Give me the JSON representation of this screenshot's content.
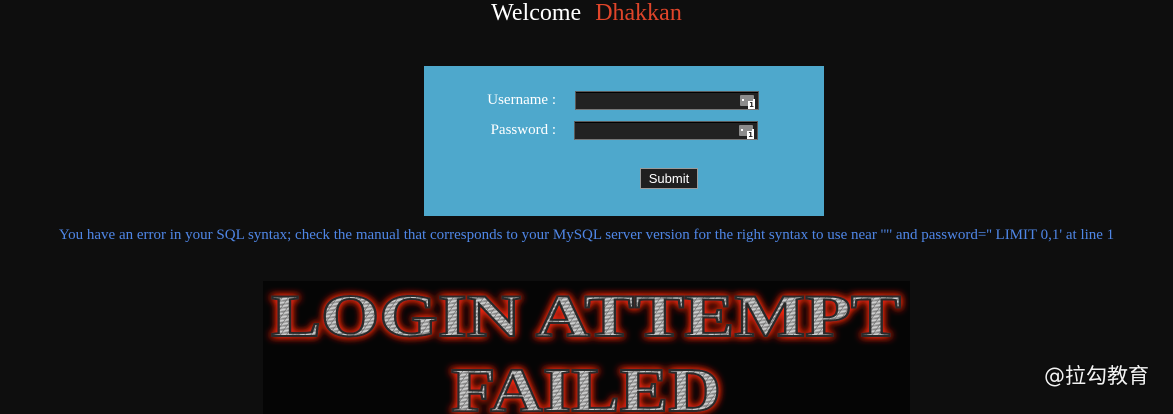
{
  "header": {
    "welcome": "Welcome",
    "user_name": "Dhakkan"
  },
  "login_form": {
    "username_label": "Username :",
    "password_label": "Password :",
    "username_value": "",
    "password_value": "",
    "submit_label": "Submit"
  },
  "error": {
    "message": "You have an error in your SQL syntax; check the manual that corresponds to your MySQL server version for the right syntax to use near '\"' and password='' LIMIT 0,1' at line 1"
  },
  "banner": {
    "line1": "LOGIN ATTEMPT",
    "line2": "FAILED"
  },
  "watermark": {
    "text": "@拉勾教育"
  },
  "colors": {
    "background": "#0e0e0e",
    "form_bg": "#4ea8cc",
    "username_accent": "#e0452a",
    "error_text": "#4f86e6"
  }
}
